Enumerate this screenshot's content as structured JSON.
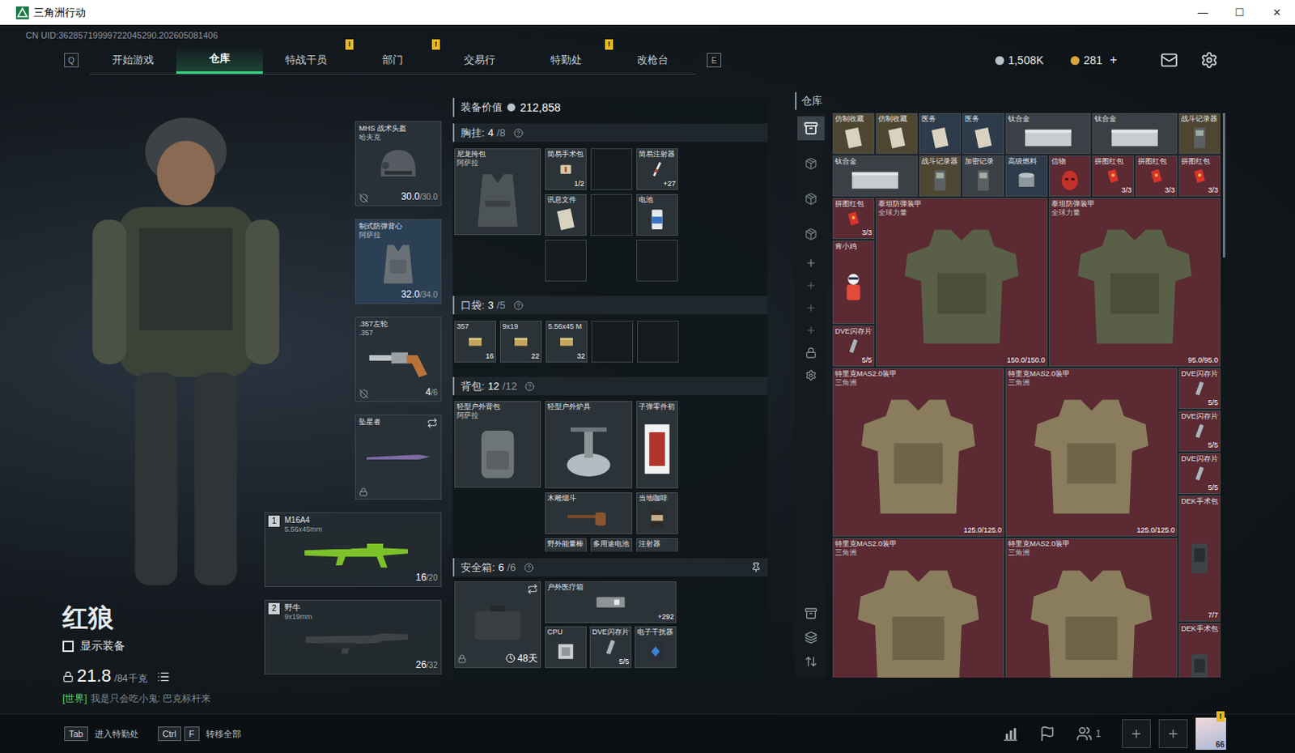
{
  "window": {
    "title": "三角洲行动",
    "controls": [
      "—",
      "☐",
      "✕"
    ]
  },
  "uid": "CN UID:36285719999722045290.202605081406",
  "nav": {
    "prev_key": "Q",
    "next_key": "E",
    "alert_mark": "!",
    "tabs": [
      {
        "label": "开始游戏",
        "selected": false,
        "alert": false
      },
      {
        "label": "仓库",
        "selected": true,
        "alert": false
      },
      {
        "label": "特战干员",
        "selected": false,
        "alert": true
      },
      {
        "label": "部门",
        "selected": false,
        "alert": true
      },
      {
        "label": "交易行",
        "selected": false,
        "alert": false
      },
      {
        "label": "特勤处",
        "selected": false,
        "alert": true
      },
      {
        "label": "改枪台",
        "selected": false,
        "alert": false
      }
    ]
  },
  "currency": {
    "coins": "1,508K",
    "tickets": "281",
    "add": "+"
  },
  "character": {
    "name": "红狼",
    "show_gear": {
      "label": "显示装备",
      "checked": false
    },
    "weight": "21.8",
    "weight_max": "/84千克",
    "chat": {
      "channel": "[世界]",
      "text": "我是只会吃小鬼: 巴克标杆来"
    }
  },
  "slots": [
    {
      "name": "MHS 战术头盔",
      "sub": "哈夫克",
      "value": "30.0",
      "max": "/30.0",
      "kind": "helmet",
      "color": "#283038",
      "marked": true,
      "locked": false,
      "swap": false
    },
    {
      "name": "制式防弹背心",
      "sub": "阿萨拉",
      "value": "32.0",
      "max": "/34.0",
      "kind": "vest",
      "color": "#2b3f55",
      "marked": false,
      "locked": false,
      "swap": false
    },
    {
      "name": ".357左轮",
      "sub": ".357",
      "value": "4",
      "max": "/6",
      "kind": "revolver",
      "color": "#283038",
      "marked": true,
      "locked": false,
      "swap": false
    },
    {
      "name": "坠星者",
      "kind": "knife",
      "color": "#283038",
      "marked": false,
      "locked": true,
      "swap": true
    }
  ],
  "weapons": [
    {
      "slot": "1",
      "name": "M16A4",
      "caliber": "5.56x45mm",
      "ammo": "16",
      "max": "/20",
      "kind": "rifle"
    },
    {
      "slot": "2",
      "name": "野牛",
      "caliber": "9x19mm",
      "ammo": "26",
      "max": "/32",
      "kind": "smg"
    }
  ],
  "loadout": {
    "value_label": "装备价值",
    "value": "212,858",
    "chest": {
      "title": "胸挂:",
      "used": "4",
      "capacity": "/8",
      "container": {
        "name": "尼龙挎包",
        "sub": "阿萨拉",
        "kind": "rig"
      },
      "items": [
        {
          "name": "简易手术包",
          "count": "1/2",
          "kind": "medkit"
        },
        {
          "kind": "empty"
        },
        {
          "name": "简易注射器",
          "count": "+27",
          "kind": "syringe"
        },
        {
          "name": "讯息文件",
          "kind": "paper"
        },
        {
          "kind": "empty"
        },
        {
          "name": "电池",
          "kind": "battery"
        },
        {
          "kind": "empty"
        },
        {
          "kind": "empty"
        }
      ]
    },
    "pockets": {
      "title": "口袋:",
      "used": "3",
      "capacity": "/5",
      "items": [
        {
          "name": "357",
          "count": "16",
          "kind": "ammo"
        },
        {
          "name": "9x19",
          "count": "22",
          "kind": "ammo"
        },
        {
          "name": "5.56x45 M",
          "count": "32",
          "kind": "ammo"
        },
        {
          "kind": "empty"
        },
        {
          "kind": "empty"
        }
      ]
    },
    "backpack": {
      "title": "背包:",
      "used": "12",
      "capacity": "/12",
      "container": {
        "name": "轻型户外背包",
        "sub": "阿萨拉",
        "kind": "pack"
      },
      "items": [
        {
          "name": "轻型户外炉具",
          "kind": "stove"
        },
        {
          "name": "子弹零件初",
          "kind": "card"
        },
        {
          "name": "木雕烟斗",
          "kind": "pipe"
        },
        {
          "name": "当地咖啡",
          "kind": "jar"
        },
        {
          "name": "野外能量棒",
          "kind": "bar"
        },
        {
          "name": "多用途电池",
          "kind": "battery"
        },
        {
          "name": "注射器",
          "kind": "syringe"
        }
      ]
    },
    "safe": {
      "title": "安全箱:",
      "used": "6",
      "capacity": "/6",
      "container": {
        "kind": "case",
        "time": "48天",
        "locked": true,
        "swap": true
      },
      "items": [
        {
          "name": "户外医疗箱",
          "count": "+292",
          "kind": "medcase"
        },
        {
          "name": "CPU",
          "kind": "cpu"
        },
        {
          "name": "DVE闪存片",
          "count": "5/5",
          "kind": "flash"
        },
        {
          "name": "电子干扰器",
          "kind": "jammer"
        }
      ]
    }
  },
  "warehouse": {
    "title": "仓库",
    "pages": [
      {
        "selected": true
      },
      {
        "selected": false
      },
      {
        "selected": false
      },
      {
        "selected": false
      }
    ],
    "items": [
      {
        "name": "仿制收藏",
        "kind": "paper",
        "color": "#4f4632"
      },
      {
        "name": "仿制收藏",
        "kind": "paper",
        "color": "#4f4632"
      },
      {
        "name": "医务",
        "kind": "paper",
        "color": "#2d3b4a"
      },
      {
        "name": "医务",
        "kind": "paper",
        "color": "#2d3b4a"
      },
      {
        "name": "钛合金",
        "kind": "metal",
        "color": "#3a4045"
      },
      {
        "name": "钛合金",
        "kind": "metal",
        "color": "#3a4045"
      },
      {
        "name": "战斗记录器",
        "kind": "device",
        "color": "#4f4632"
      },
      {
        "name": "钛合金",
        "kind": "metal",
        "color": "#3a4045"
      },
      {
        "name": "战斗记录器",
        "kind": "device",
        "color": "#4f4632"
      },
      {
        "name": "加密记录",
        "kind": "device",
        "color": "#3a4045"
      },
      {
        "name": "高级燃料",
        "kind": "canister",
        "color": "#2d3b4a"
      },
      {
        "name": "信物",
        "kind": "mask",
        "color": "#5b2a32"
      },
      {
        "name": "拼图红包",
        "count": "3/3",
        "kind": "envelope",
        "color": "#5b2a32"
      },
      {
        "name": "拼图红包",
        "count": "3/3",
        "kind": "envelope",
        "color": "#5b2a32"
      },
      {
        "name": "拼图红包",
        "count": "3/3",
        "kind": "envelope",
        "color": "#5b2a32"
      },
      {
        "name": "拼图红包",
        "count": "3/3",
        "kind": "envelope",
        "color": "#5b2a32"
      },
      {
        "name": "泰坦防弹装甲",
        "sub": "全球力量",
        "count": "150.0/150.0",
        "kind": "armor",
        "color": "#5b2a32"
      },
      {
        "name": "泰坦防弹装甲",
        "sub": "全球力量",
        "count": "95.0/95.0",
        "kind": "armor",
        "color": "#5b2a32"
      },
      {
        "name": "肯小鸡",
        "kind": "figure",
        "color": "#5b2a32"
      },
      {
        "name": "DVE闪存片",
        "count": "5/5",
        "kind": "flash",
        "color": "#5b2a32"
      },
      {
        "name": "特里克MAS2.0装甲",
        "sub": "三角洲",
        "count": "125.0/125.0",
        "kind": "armor2",
        "color": "#5b2a32"
      },
      {
        "name": "特里克MAS2.0装甲",
        "sub": "三角洲",
        "count": "125.0/125.0",
        "kind": "armor2",
        "color": "#5b2a32"
      },
      {
        "name": "DVE闪存片",
        "count": "5/5",
        "kind": "flash",
        "color": "#5b2a32"
      },
      {
        "name": "DVE闪存片",
        "count": "5/5",
        "kind": "flash",
        "color": "#5b2a32"
      },
      {
        "name": "DVE闪存片",
        "count": "5/5",
        "kind": "flash",
        "color": "#5b2a32"
      },
      {
        "name": "DEK手术包",
        "count": "7/7",
        "kind": "kit",
        "color": "#5b2a32"
      },
      {
        "name": "特里克MAS2.0装甲",
        "sub": "三角洲",
        "kind": "armor2",
        "color": "#5b2a32"
      },
      {
        "name": "特里克MAS2.0装甲",
        "sub": "三角洲",
        "kind": "armor2",
        "color": "#5b2a32"
      },
      {
        "name": "DEK手术包",
        "kind": "kit",
        "color": "#5b2a32"
      }
    ]
  },
  "bottom_bar": {
    "hotkeys": [
      {
        "keys": [
          "Tab"
        ],
        "label": "进入特勤处"
      },
      {
        "keys": [
          "Ctrl",
          "F"
        ],
        "label": "转移全部"
      }
    ],
    "squad_count": "1",
    "avatar": {
      "label": "66",
      "alert": true
    }
  }
}
